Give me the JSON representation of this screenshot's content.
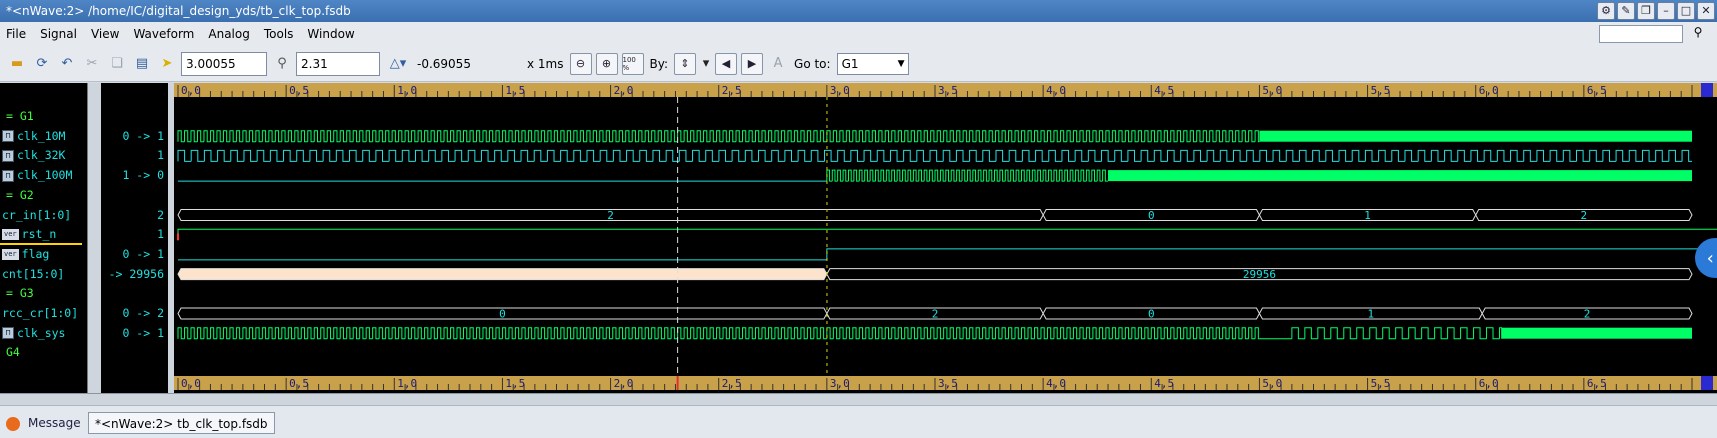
{
  "window": {
    "title": "*<nWave:2> /home/IC/digital_design_yds/tb_clk_top.fsdb"
  },
  "menubar": {
    "items": [
      "File",
      "Signal",
      "View",
      "Waveform",
      "Analog",
      "Tools",
      "Window"
    ],
    "search_placeholder": ""
  },
  "toolbar": {
    "cursor_time": "3.00055",
    "marker_time": "2.31",
    "delta": "-0.69055",
    "scale": "x 1ms",
    "by_label": "By:",
    "goto_label": "Go to:",
    "goto_value": "G1",
    "zoom_100_label": "100 %"
  },
  "signals": [
    {
      "kind": "group",
      "name": "= G1",
      "value": ""
    },
    {
      "kind": "signal",
      "name": "clk_10M",
      "value": "0 -> 1",
      "icon": "clock-icon",
      "wave": "clock-dense"
    },
    {
      "kind": "signal",
      "name": "clk_32K",
      "value": "1",
      "icon": "clock-icon",
      "wave": "clock-slow"
    },
    {
      "kind": "signal",
      "name": "clk_100M",
      "value": "1 -> 0",
      "icon": "clock-icon",
      "wave": "clock-late"
    },
    {
      "kind": "group",
      "name": "= G2",
      "value": ""
    },
    {
      "kind": "signal",
      "name": "cr_in[1:0]",
      "value": "2",
      "icon": "",
      "wave": "bus"
    },
    {
      "kind": "signal",
      "name": "rst_n",
      "value": "1",
      "icon": "ver",
      "wave": "rst"
    },
    {
      "kind": "signal",
      "name": "flag",
      "value": "0 -> 1",
      "icon": "ver",
      "wave": "flag"
    },
    {
      "kind": "signal",
      "name": "cnt[15:0]",
      "value": "-> 29956",
      "icon": "",
      "wave": "cnt"
    },
    {
      "kind": "group",
      "name": "= G3",
      "value": ""
    },
    {
      "kind": "signal",
      "name": "rcc_cr[1:0]",
      "value": "0 -> 2",
      "icon": "",
      "wave": "bus"
    },
    {
      "kind": "signal",
      "name": "clk_sys",
      "value": "0 -> 1",
      "icon": "clock-icon",
      "wave": "clk-sys"
    },
    {
      "kind": "group",
      "name": "G4",
      "value": ""
    }
  ],
  "timeline": {
    "ticks": [
      "0,0",
      "0,5",
      "1,0",
      "1,5",
      "2,0",
      "2,5",
      "3,0",
      "3,5",
      "4,0",
      "4,5",
      "5,0",
      "5,5",
      "6,0",
      "6,5",
      "0"
    ],
    "range_ms": [
      0,
      7
    ],
    "cursor_ms": 3.00055,
    "marker_ms": 2.31
  },
  "buses": {
    "cr_in": [
      {
        "label": "2",
        "from": 0,
        "to": 4.0
      },
      {
        "label": "0",
        "from": 4.0,
        "to": 5.0
      },
      {
        "label": "1",
        "from": 5.0,
        "to": 6.0
      },
      {
        "label": "2",
        "from": 6.0,
        "to": 7.0
      }
    ],
    "cnt": [
      {
        "label": "",
        "from": 0,
        "to": 3.0
      },
      {
        "label": "29956",
        "from": 3.0,
        "to": 7.0
      }
    ],
    "rcc_cr": [
      {
        "label": "0",
        "from": 0,
        "to": 3.0
      },
      {
        "label": "2",
        "from": 3.0,
        "to": 4.0
      },
      {
        "label": "0",
        "from": 4.0,
        "to": 5.0
      },
      {
        "label": "1",
        "from": 5.0,
        "to": 6.03
      },
      {
        "label": "2",
        "from": 6.03,
        "to": 7.0
      }
    ]
  },
  "statusbar": {
    "tab_message": "Message",
    "tab_wave": "*<nWave:2> tb_clk_top.fsdb"
  },
  "colors": {
    "wave_green": "#00ff66",
    "wave_cyan": "#20e0e0",
    "cnt_fill": "#fde3cc",
    "group": "#40ff40"
  }
}
